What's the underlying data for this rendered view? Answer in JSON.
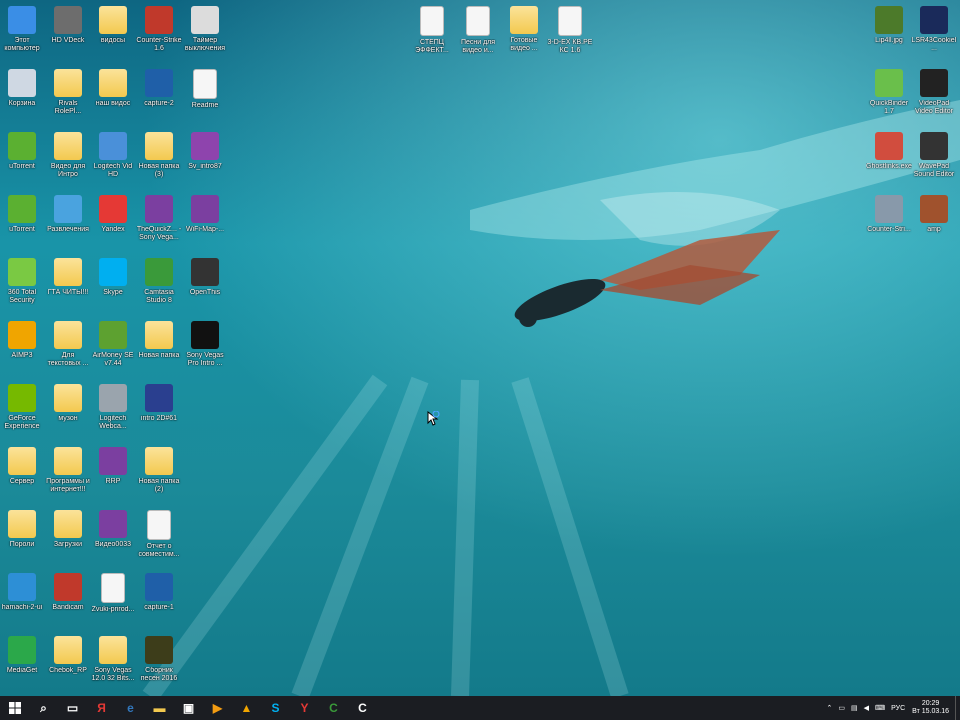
{
  "desktop_icons": [
    {
      "label": "Этот компьютер",
      "color": "#3a8ee6",
      "kind": "tile"
    },
    {
      "label": "HD VDeck",
      "color": "#6d6d6d",
      "kind": "tile"
    },
    {
      "label": "видосы",
      "color": "#e8c25a",
      "kind": "folder"
    },
    {
      "label": "Counter-Strike 1.6",
      "color": "#c0392b",
      "kind": "tile"
    },
    {
      "label": "Таймер выключения",
      "color": "#dcdcdc",
      "kind": "tile"
    },
    {
      "label": "Корзина",
      "color": "#cfd8e3",
      "kind": "tile"
    },
    {
      "label": "Rivals RolePl...",
      "color": "#f3c94f",
      "kind": "folder"
    },
    {
      "label": "наш видос",
      "color": "#f3c94f",
      "kind": "folder"
    },
    {
      "label": "capture-2",
      "color": "#1f5fa8",
      "kind": "tile"
    },
    {
      "label": "Readme",
      "color": "#ffffff",
      "kind": "doc"
    },
    {
      "label": "uTorrent",
      "color": "#5bb031",
      "kind": "tile"
    },
    {
      "label": "Видео для Интро",
      "color": "#f3c94f",
      "kind": "folder"
    },
    {
      "label": "Logitech Vid HD",
      "color": "#4a90d9",
      "kind": "tile"
    },
    {
      "label": "Новая папка (3)",
      "color": "#f3c94f",
      "kind": "folder"
    },
    {
      "label": "Sv_intro87",
      "color": "#8e44ad",
      "kind": "tile"
    },
    {
      "label": "uTorrent",
      "color": "#5bb031",
      "kind": "tile"
    },
    {
      "label": "Развлечения",
      "color": "#4aa3df",
      "kind": "tile"
    },
    {
      "label": "Yandex",
      "color": "#e53935",
      "kind": "tile"
    },
    {
      "label": "TheQuickZ... - Sony Vega...",
      "color": "#7b3fa0",
      "kind": "tile"
    },
    {
      "label": "WiFi-Map-...",
      "color": "#7b3fa0",
      "kind": "tile"
    },
    {
      "label": "360 Total Security",
      "color": "#7ac943",
      "kind": "tile"
    },
    {
      "label": "ГТА ЧИТЫ!!!",
      "color": "#f3c94f",
      "kind": "folder"
    },
    {
      "label": "Skype",
      "color": "#00aff0",
      "kind": "tile"
    },
    {
      "label": "Camtasia Studio 8",
      "color": "#3a9a3a",
      "kind": "tile"
    },
    {
      "label": "OpenThis",
      "color": "#333333",
      "kind": "tile"
    },
    {
      "label": "AIMP3",
      "color": "#f0a500",
      "kind": "tile"
    },
    {
      "label": "Для текстовых ...",
      "color": "#f3c94f",
      "kind": "folder"
    },
    {
      "label": "AirMoney SE v7.44",
      "color": "#5da130",
      "kind": "tile"
    },
    {
      "label": "Новая папка",
      "color": "#f3c94f",
      "kind": "folder"
    },
    {
      "label": "Sony Vegas Pro Intro ...",
      "color": "#111111",
      "kind": "tile"
    },
    {
      "label": "GeForce Experience",
      "color": "#76b900",
      "kind": "tile"
    },
    {
      "label": "музон",
      "color": "#f3c94f",
      "kind": "folder"
    },
    {
      "label": "Logitech Webca...",
      "color": "#9aa4ad",
      "kind": "tile"
    },
    {
      "label": "intro 2D#61",
      "color": "#2a3f8f",
      "kind": "tile"
    },
    {
      "label": "Сервер",
      "color": "#f3c94f",
      "kind": "folder"
    },
    {
      "label": "Программы и интернет!!!",
      "color": "#f3c94f",
      "kind": "folder"
    },
    {
      "label": "RRP",
      "color": "#7b3fa0",
      "kind": "tile"
    },
    {
      "label": "Новая папка (2)",
      "color": "#f3c94f",
      "kind": "folder"
    },
    {
      "label": "Пороли",
      "color": "#f3c94f",
      "kind": "folder"
    },
    {
      "label": "Загрузки",
      "color": "#f3c94f",
      "kind": "folder"
    },
    {
      "label": "Видео0033",
      "color": "#7b3fa0",
      "kind": "tile"
    },
    {
      "label": "Отчет о совместим...",
      "color": "#ffffff",
      "kind": "doc"
    },
    {
      "label": "hamachi-2-ui",
      "color": "#2d8fd6",
      "kind": "tile"
    },
    {
      "label": "Bandicam",
      "color": "#c0392b",
      "kind": "tile"
    },
    {
      "label": "Zvuki-prirod...",
      "color": "#ffffff",
      "kind": "doc"
    },
    {
      "label": "capture-1",
      "color": "#1f5fa8",
      "kind": "tile"
    },
    {
      "label": "MediaGet",
      "color": "#2ba84a",
      "kind": "tile"
    },
    {
      "label": "Chebok_RP",
      "color": "#f3c94f",
      "kind": "folder"
    },
    {
      "label": "Sony Vegas 12.0 32 Bits...",
      "color": "#f3c94f",
      "kind": "folder"
    },
    {
      "label": "Сборник песен 2016",
      "color": "#3d3d1a",
      "kind": "tile"
    },
    {
      "label": "СТЕПЦ ЭФФЕКТ...",
      "color": "#f2f2f2",
      "kind": "doc"
    },
    {
      "label": "Песни для видео и...",
      "color": "#f2f2f2",
      "kind": "doc"
    },
    {
      "label": "Готовые видео ...",
      "color": "#f3c94f",
      "kind": "folder"
    },
    {
      "label": "3-D-ЕХ КВ.PE КС 1.6",
      "color": "#f2f2f2",
      "kind": "doc"
    },
    {
      "label": "Lip4ll.jpg",
      "color": "#4c7a2a",
      "kind": "tile"
    },
    {
      "label": "LSR43CookieI...",
      "color": "#1a2a5a",
      "kind": "tile"
    },
    {
      "label": "QuickBinder 1.7",
      "color": "#6abf4b",
      "kind": "tile"
    },
    {
      "label": "VideoPad Video Editor",
      "color": "#222222",
      "kind": "tile"
    },
    {
      "label": "Ghostlinks.exe",
      "color": "#d14d3e",
      "kind": "tile"
    },
    {
      "label": "WavePad Sound Editor",
      "color": "#333333",
      "kind": "tile"
    },
    {
      "label": "Counter-Stri...",
      "color": "#8899aa",
      "kind": "tile"
    },
    {
      "label": "amp",
      "color": "#a0522d",
      "kind": "tile"
    }
  ],
  "taskbar": {
    "start_icon": "windows-logo-icon",
    "items": [
      {
        "name": "search",
        "color": "#ffffff",
        "glyph": "⌕"
      },
      {
        "name": "task-view",
        "color": "#ffffff",
        "glyph": "▭"
      },
      {
        "name": "yandex",
        "color": "#e53935",
        "glyph": "Я"
      },
      {
        "name": "edge",
        "color": "#3277bc",
        "glyph": "e"
      },
      {
        "name": "file-explorer",
        "color": "#f3c94f",
        "glyph": "▬"
      },
      {
        "name": "store",
        "color": "#ffffff",
        "glyph": "▣"
      },
      {
        "name": "media-player",
        "color": "#f39c12",
        "glyph": "▶"
      },
      {
        "name": "aimp",
        "color": "#f0a500",
        "glyph": "▲"
      },
      {
        "name": "skype",
        "color": "#00aff0",
        "glyph": "S"
      },
      {
        "name": "yandex-browser",
        "color": "#e53935",
        "glyph": "Y"
      },
      {
        "name": "camtasia",
        "color": "#3a9a3a",
        "glyph": "C"
      },
      {
        "name": "camtasia-recorder",
        "color": "#ffffff",
        "glyph": "C"
      }
    ],
    "tray": {
      "lang": "РУС",
      "time": "20:29",
      "date": "Вт 15.03.16"
    }
  }
}
